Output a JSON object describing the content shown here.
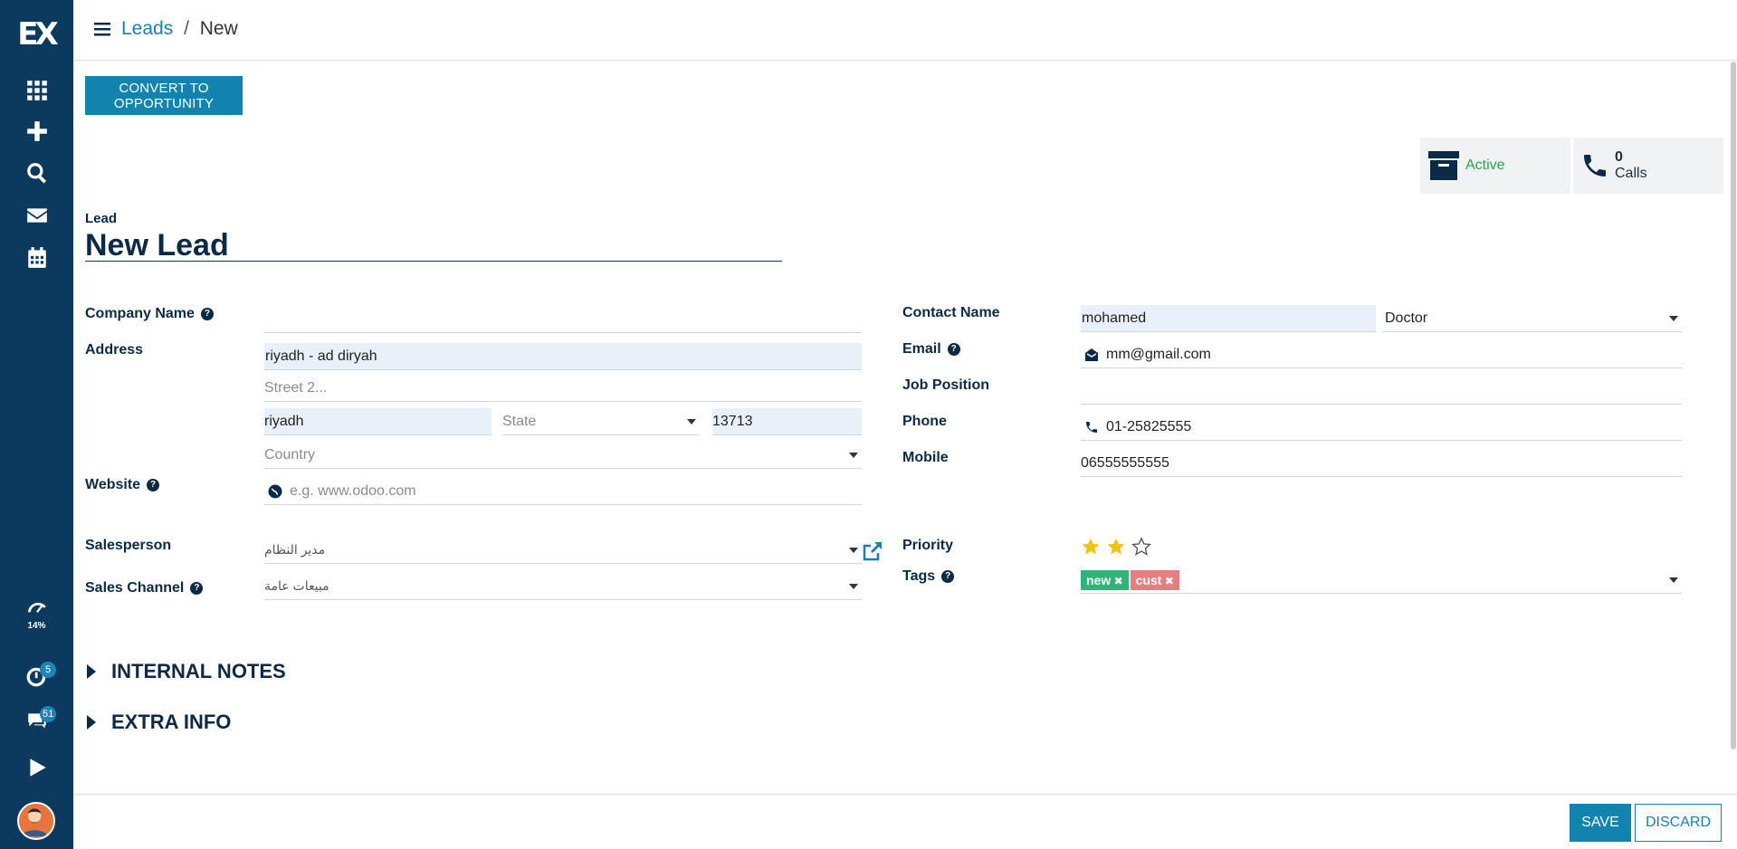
{
  "sidebar": {
    "logo": "EX",
    "items": [
      {
        "icon": "apps-grid-icon"
      },
      {
        "icon": "plus-icon"
      },
      {
        "icon": "search-icon"
      },
      {
        "icon": "envelope-icon"
      },
      {
        "icon": "calendar-icon"
      }
    ],
    "progress_pct": "14%",
    "activity_badge": "5",
    "messages_badge": "51",
    "play_icon": "play-icon"
  },
  "header": {
    "breadcrumb_parent": "Leads",
    "breadcrumb_sep": "/",
    "breadcrumb_current": "New"
  },
  "actions": {
    "convert_label": "CONVERT TO OPPORTUNITY",
    "save_label": "SAVE",
    "discard_label": "DISCARD"
  },
  "stats": {
    "active_label": "Active",
    "calls_count": "0",
    "calls_label": "Calls"
  },
  "lead": {
    "label": "Lead",
    "title": "New Lead"
  },
  "left": {
    "company_label": "Company Name",
    "company_value": "",
    "address_label": "Address",
    "street": "riyadh - ad diryah",
    "street2_placeholder": "Street 2...",
    "city": "riyadh",
    "state_placeholder": "State",
    "zip": "13713",
    "country_placeholder": "Country",
    "website_label": "Website",
    "website_placeholder": "e.g. www.odoo.com",
    "salesperson_label": "Salesperson",
    "salesperson_value": "مدير النظام",
    "channel_label": "Sales Channel",
    "channel_value": "مبيعات عامة"
  },
  "right": {
    "contact_label": "Contact Name",
    "contact_value": "mohamed",
    "title_value": "Doctor",
    "email_label": "Email",
    "email_value": "mm@gmail.com",
    "job_label": "Job Position",
    "job_value": "",
    "phone_label": "Phone",
    "phone_value": "01-25825555",
    "mobile_label": "Mobile",
    "mobile_value": "06555555555",
    "priority_label": "Priority",
    "priority_stars": 2,
    "priority_max": 3,
    "tags_label": "Tags",
    "tags": [
      {
        "label": "new",
        "color": "#2fb57a"
      },
      {
        "label": "cust",
        "color": "#e57f7f"
      }
    ]
  },
  "sections": {
    "internal_notes": "INTERNAL NOTES",
    "extra_info": "EXTRA INFO"
  },
  "colors": {
    "sidebar": "#0b3a5e",
    "primary": "#1083af",
    "active_green": "#28a745",
    "star": "#f3c10f"
  }
}
